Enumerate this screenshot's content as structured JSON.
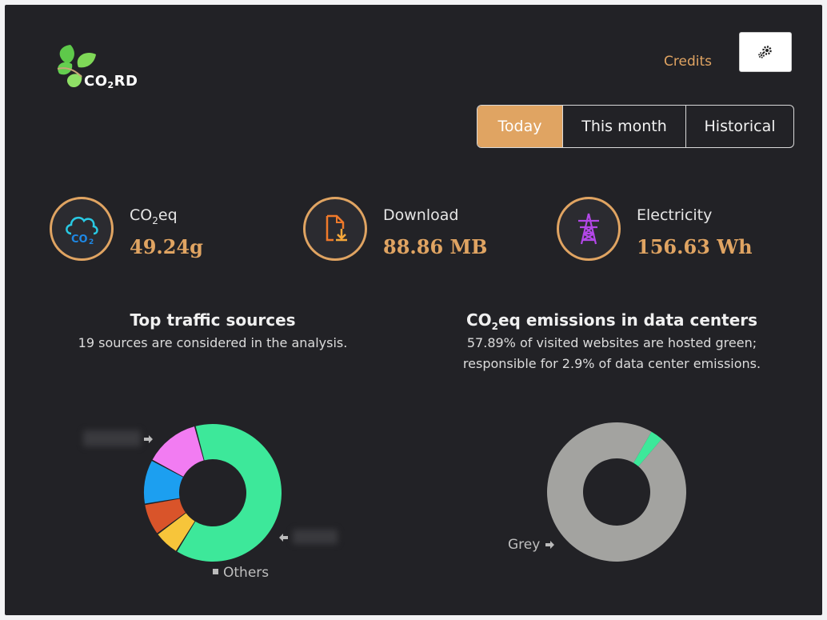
{
  "brand": {
    "name_prefix": "CO",
    "name_sub": "2",
    "name_suffix": "RD"
  },
  "header": {
    "credits_label": "Credits",
    "settings_icon": "gears-icon"
  },
  "tabs": [
    {
      "label": "Today",
      "active": true
    },
    {
      "label": "This month",
      "active": false
    },
    {
      "label": "Historical",
      "active": false
    }
  ],
  "stats": {
    "co2": {
      "label_prefix": "CO",
      "label_sub": "2",
      "label_suffix": "eq",
      "value": "49.24g",
      "icon": "co2-cloud-icon"
    },
    "download": {
      "label": "Download",
      "value": "88.86 MB",
      "icon": "file-download-icon"
    },
    "electricity": {
      "label": "Electricity",
      "value": "156.63 Wh",
      "icon": "power-tower-icon"
    }
  },
  "traffic": {
    "title": "Top traffic sources",
    "subtitle": "19 sources are considered in the analysis.",
    "others_label": "Others"
  },
  "emissions": {
    "title_prefix": "CO",
    "title_sub": "2",
    "title_suffix": "eq emissions in data centers",
    "subtitle_line1": "57.89% of visited websites are hosted green;",
    "subtitle_line2": "responsible for 2.9% of data center emissions.",
    "grey_label": "Grey"
  },
  "colors": {
    "accent": "#e0a462",
    "panel_bg": "#222226",
    "green": "#3de89a",
    "yellow": "#f7c53a",
    "red": "#d9542a",
    "blue": "#1c9ff0",
    "pink": "#f27cf2",
    "grey": "#a3a3a0"
  },
  "chart_data": [
    {
      "type": "pie",
      "title": "Top traffic sources",
      "slices": [
        {
          "label": "",
          "value": 63,
          "color": "#3de89a"
        },
        {
          "label": "",
          "value": 6,
          "color": "#f7c53a"
        },
        {
          "label": "",
          "value": 7.5,
          "color": "#d9542a"
        },
        {
          "label": "",
          "value": 10.5,
          "color": "#1c9ff0"
        },
        {
          "label": "Others",
          "value": 13,
          "color": "#f27cf2"
        }
      ]
    },
    {
      "type": "pie",
      "title": "CO2eq emissions in data centers",
      "slices": [
        {
          "label": "",
          "value": 2.9,
          "color": "#3de89a"
        },
        {
          "label": "Grey",
          "value": 97.1,
          "color": "#a3a3a0"
        }
      ]
    }
  ]
}
